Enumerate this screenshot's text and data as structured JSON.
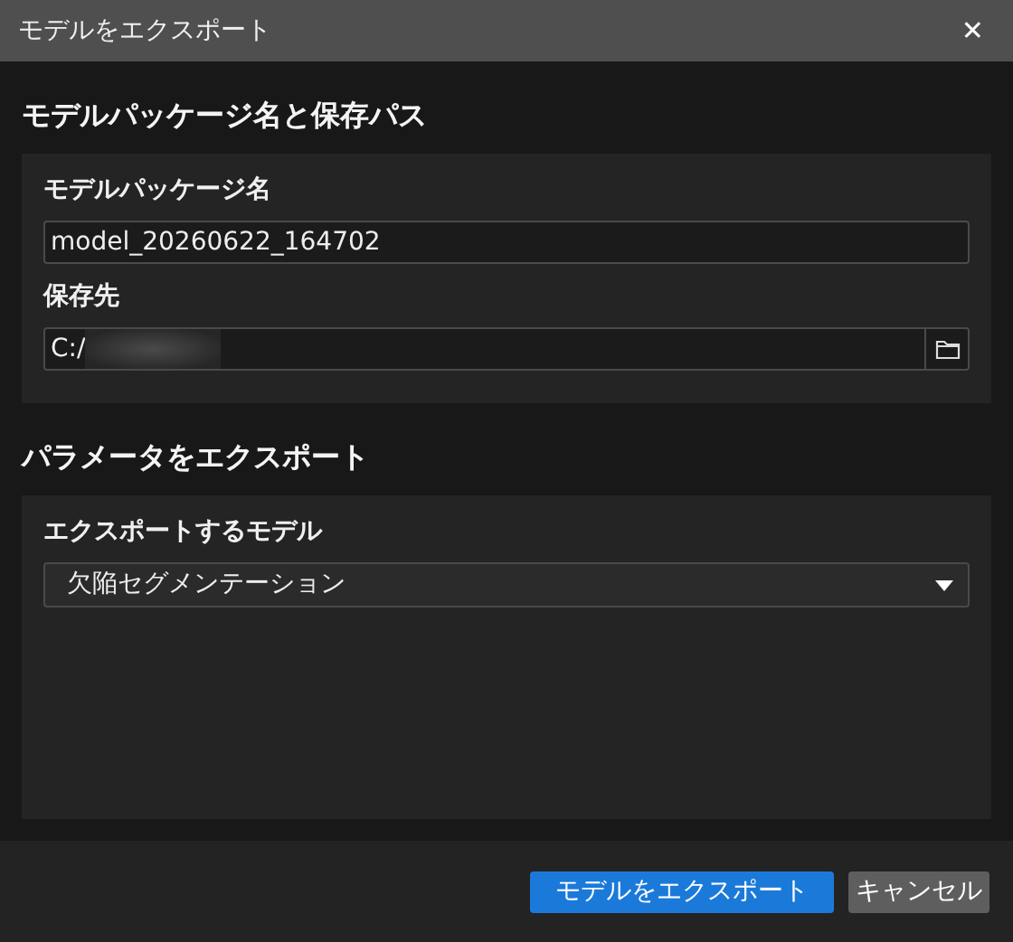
{
  "window": {
    "title": "モデルをエクスポート",
    "close": "✕"
  },
  "sections": [
    {
      "heading": "モデルパッケージ名と保存パス",
      "fields": [
        {
          "kind": "text",
          "label": "モデルパッケージ名",
          "value": "model_20260622_164702"
        },
        {
          "kind": "path",
          "label": "保存先",
          "value": "C:/",
          "redacted": true
        }
      ]
    },
    {
      "heading": "パラメータをエクスポート",
      "fields": [
        {
          "kind": "select",
          "label": "エクスポートするモデル",
          "value": "欠陥セグメンテーション"
        }
      ]
    }
  ],
  "buttons": [
    {
      "label": "モデルをエクスポート",
      "kind": "primary"
    },
    {
      "label": "キャンセル",
      "kind": "secondary"
    }
  ]
}
